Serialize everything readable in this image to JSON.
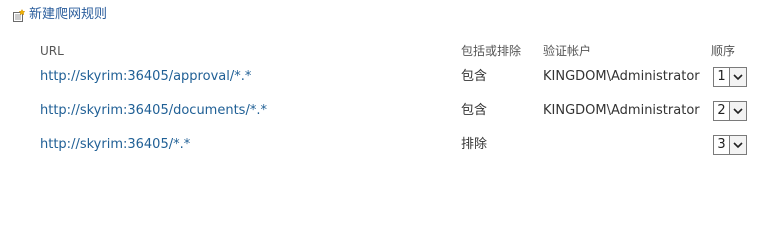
{
  "new_rule": {
    "label": "新建爬网规则",
    "icon": "new-document-icon"
  },
  "table": {
    "headers": {
      "url": "URL",
      "include_exclude": "包括或排除",
      "auth_account": "验证帐户",
      "order": "顺序"
    },
    "rows": [
      {
        "url": "http://skyrim:36405/approval/*.*",
        "include_exclude": "包含",
        "auth_account": "KINGDOM\\Administrator",
        "order": "1"
      },
      {
        "url": "http://skyrim:36405/documents/*.*",
        "include_exclude": "包含",
        "auth_account": "KINGDOM\\Administrator",
        "order": "2"
      },
      {
        "url": "http://skyrim:36405/*.*",
        "include_exclude": "排除",
        "auth_account": "",
        "order": "3"
      }
    ]
  },
  "colors": {
    "link": "#1f5f95",
    "text": "#333333",
    "header": "#555555"
  }
}
